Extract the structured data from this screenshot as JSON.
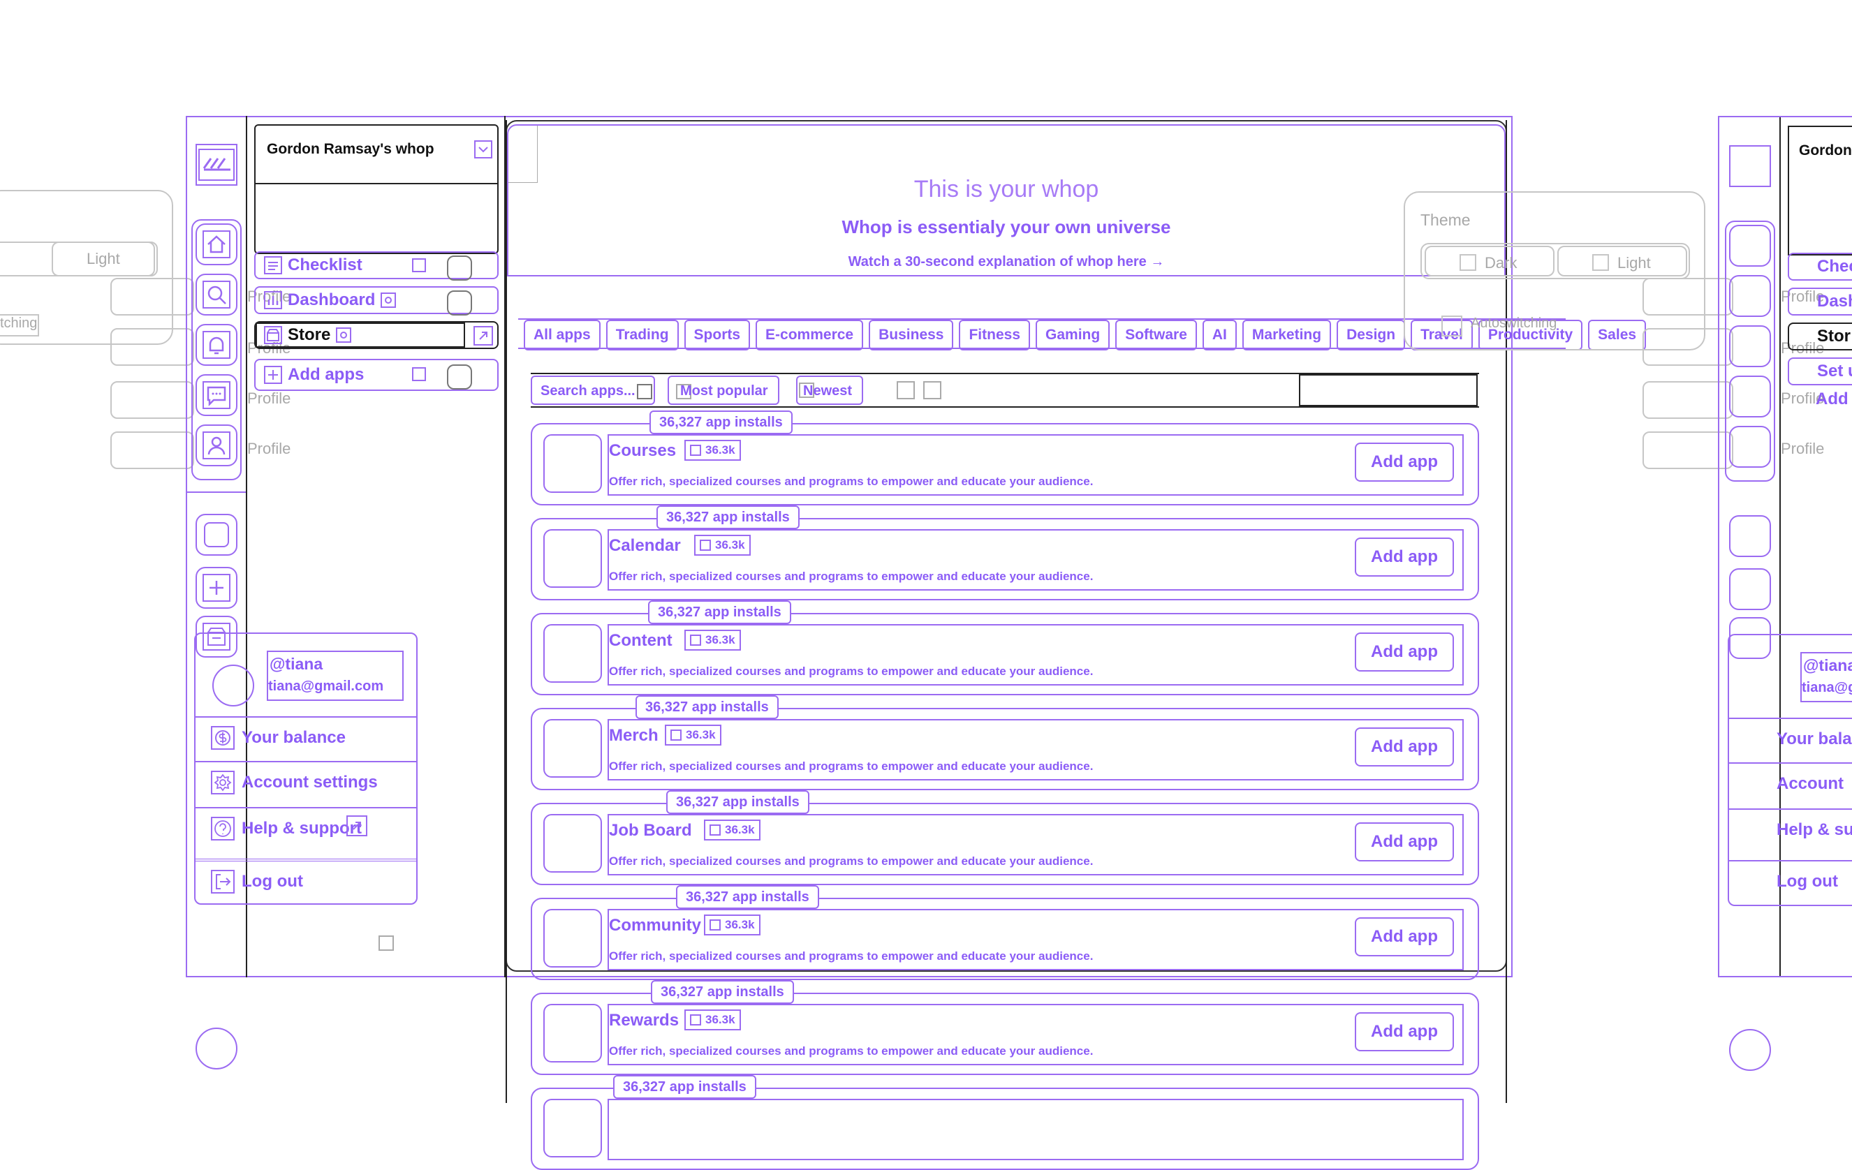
{
  "workspace": {
    "title": "Gordon Ramsay's whop"
  },
  "sidebar": {
    "items": [
      {
        "label": "Checklist"
      },
      {
        "label": "Dashboard"
      },
      {
        "label": "Store"
      },
      {
        "label": "Add apps"
      }
    ]
  },
  "right_clip": {
    "workspace_title": "Gordon",
    "items": [
      "Chec",
      "Dash",
      "Stor",
      "Set u",
      "Add"
    ],
    "menu": [
      "@tiana",
      "tiana@g",
      "Your bala",
      "Account",
      "Help & su",
      "Log out"
    ]
  },
  "ghost": {
    "profile_label": "Profile",
    "theme_label": "Theme",
    "dark_label": "Dark",
    "light_label": "Light",
    "switching_label": "Autoswitching",
    "left_switching": "tching",
    "left_light": "Light"
  },
  "hero": {
    "title": "This is your whop",
    "subtitle": "Whop is essentialy your own universe",
    "link": "Watch a 30-second explanation of whop here →"
  },
  "tabs": [
    "All apps",
    "Trading",
    "Sports",
    "E-commerce",
    "Business",
    "Fitness",
    "Gaming",
    "Software",
    "AI",
    "Marketing",
    "Design",
    "Travel",
    "Productivity",
    "Sales"
  ],
  "filters": {
    "search_placeholder": "Search apps...",
    "sort_popular": "Most popular",
    "sort_newest": "Newest"
  },
  "apps": [
    {
      "name": "Courses",
      "installs_badge": "36,327 app installs",
      "count": "36.3k",
      "description": "Offer rich, specialized courses and programs to empower and educate your audience.",
      "action": "Add app"
    },
    {
      "name": "Calendar",
      "installs_badge": "36,327 app installs",
      "count": "36.3k",
      "description": "Offer rich, specialized courses and programs to empower and educate your audience.",
      "action": "Add app"
    },
    {
      "name": "Content",
      "installs_badge": "36,327 app installs",
      "count": "36.3k",
      "description": "Offer rich, specialized courses and programs to empower and educate your audience.",
      "action": "Add app"
    },
    {
      "name": "Merch",
      "installs_badge": "36,327 app installs",
      "count": "36.3k",
      "description": "Offer rich, specialized courses and programs to empower and educate your audience.",
      "action": "Add app"
    },
    {
      "name": "Job Board",
      "installs_badge": "36,327 app installs",
      "count": "36.3k",
      "description": "Offer rich, specialized courses and programs to empower and educate your audience.",
      "action": "Add app"
    },
    {
      "name": "Community",
      "installs_badge": "36,327 app installs",
      "count": "36.3k",
      "description": "Offer rich, specialized courses and programs to empower and educate your audience.",
      "action": "Add app"
    },
    {
      "name": "Rewards",
      "installs_badge": "36,327 app installs",
      "count": "36.3k",
      "description": "Offer rich, specialized courses and programs to empower and educate your audience.",
      "action": "Add app"
    },
    {
      "name": "",
      "installs_badge": "36,327 app installs",
      "count": "",
      "description": "",
      "action": ""
    }
  ],
  "user_menu": {
    "handle": "@tiana",
    "email": "tiana@gmail.com",
    "items": [
      {
        "label": "Your balance"
      },
      {
        "label": "Account settings"
      },
      {
        "label": "Help & support"
      },
      {
        "label": "Log out"
      }
    ]
  },
  "colors": {
    "accent": "#8b5cf6",
    "ghost": "#c6c6c6",
    "frame": "#222222"
  }
}
